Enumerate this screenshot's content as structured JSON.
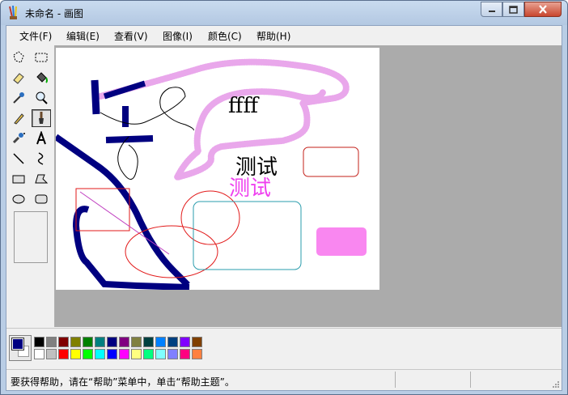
{
  "window": {
    "title": "未命名 - 画图"
  },
  "menu": {
    "file": "文件(F)",
    "edit": "编辑(E)",
    "view": "查看(V)",
    "image": "图像(I)",
    "colors": "颜色(C)",
    "help": "帮助(H)"
  },
  "tools": [
    {
      "name": "free-select-icon"
    },
    {
      "name": "rect-select-icon"
    },
    {
      "name": "eraser-icon"
    },
    {
      "name": "fill-bucket-icon"
    },
    {
      "name": "color-picker-icon"
    },
    {
      "name": "magnifier-icon"
    },
    {
      "name": "pencil-icon"
    },
    {
      "name": "brush-icon",
      "selected": true
    },
    {
      "name": "airbrush-icon"
    },
    {
      "name": "text-icon"
    },
    {
      "name": "line-icon"
    },
    {
      "name": "curve-icon"
    },
    {
      "name": "rectangle-icon"
    },
    {
      "name": "polygon-icon"
    },
    {
      "name": "ellipse-icon"
    },
    {
      "name": "rounded-rect-icon"
    }
  ],
  "canvas": {
    "text_ffff": "ffff",
    "text_test_black": "测试",
    "text_test_pink": "测试"
  },
  "palette": {
    "foreground": "#000080",
    "background": "#ffffff",
    "row1": [
      "#000000",
      "#808080",
      "#800000",
      "#808000",
      "#008000",
      "#008080",
      "#000080",
      "#800080",
      "#808040",
      "#004040",
      "#0080ff",
      "#004080",
      "#8000ff",
      "#804000"
    ],
    "row2": [
      "#ffffff",
      "#c0c0c0",
      "#ff0000",
      "#ffff00",
      "#00ff00",
      "#00ffff",
      "#0000ff",
      "#ff00ff",
      "#ffff80",
      "#00ff80",
      "#80ffff",
      "#8080ff",
      "#ff0080",
      "#ff8040"
    ]
  },
  "status": {
    "text": "要获得帮助，请在“帮助”菜单中，单击“帮助主题”。"
  }
}
